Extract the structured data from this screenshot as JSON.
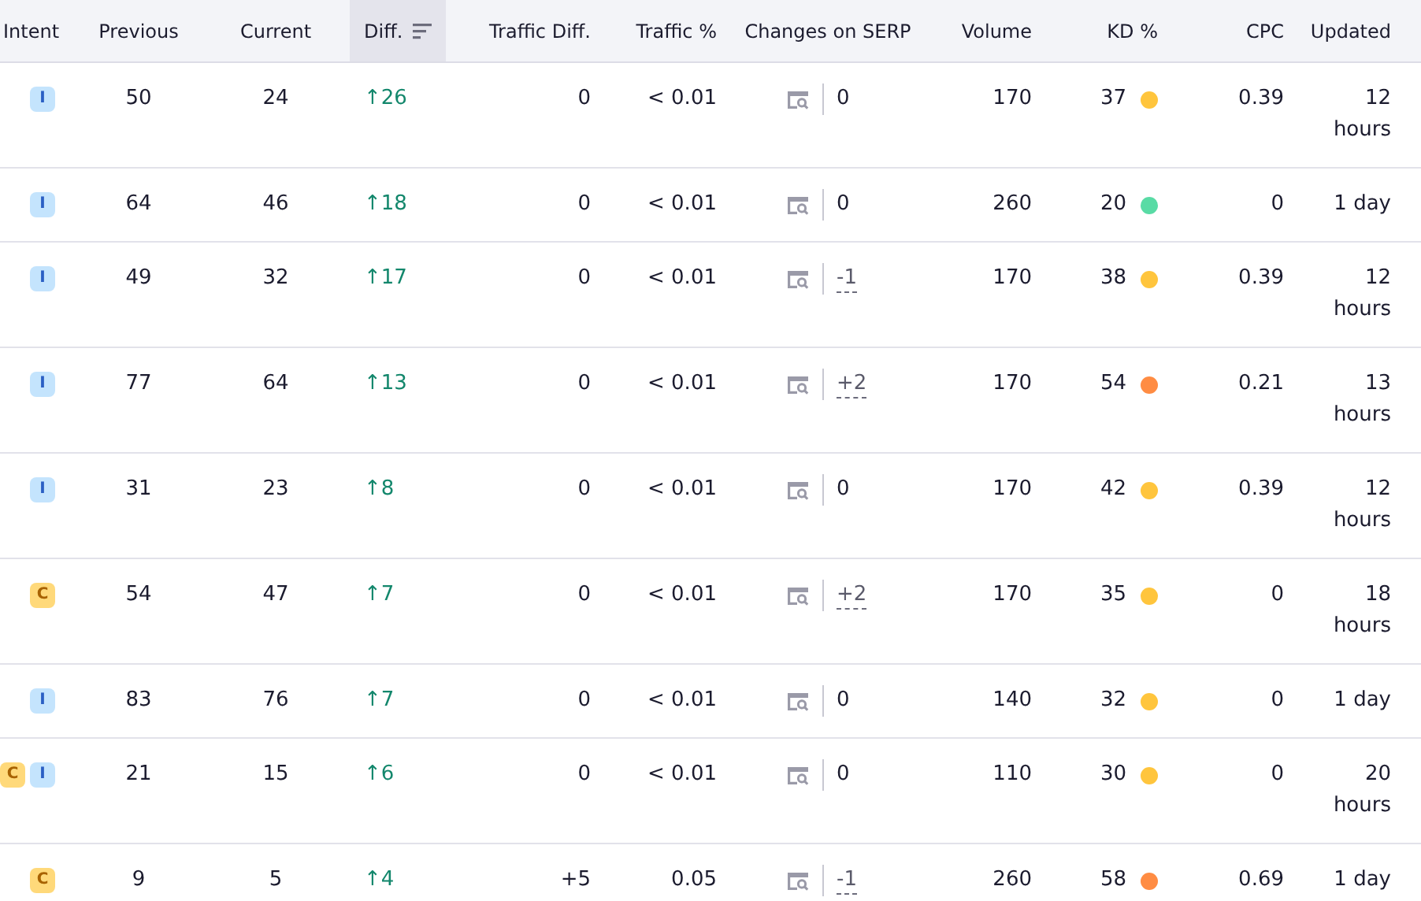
{
  "table": {
    "columns": [
      {
        "label": "Intent",
        "sorted": false
      },
      {
        "label": "Previous",
        "sorted": false
      },
      {
        "label": "Current",
        "sorted": false
      },
      {
        "label": "Diff.",
        "sorted": true
      },
      {
        "label": "Traffic Diff.",
        "sorted": false
      },
      {
        "label": "Traffic %",
        "sorted": false
      },
      {
        "label": "Changes on SERP",
        "sorted": false
      },
      {
        "label": "Volume",
        "sorted": false
      },
      {
        "label": "KD %",
        "sorted": false
      },
      {
        "label": "CPC",
        "sorted": false
      },
      {
        "label": "Updated",
        "sorted": false
      }
    ],
    "rows": [
      {
        "intents": [
          {
            "kind": "informational",
            "label": "I"
          }
        ],
        "previous": "50",
        "current": "24",
        "diff": "↑26",
        "traffic_diff": "0",
        "traffic_pct": "< 0.01",
        "serp_changes": {
          "value": "0",
          "underlined": false
        },
        "volume": "170",
        "kd": {
          "value": "37",
          "color": "#ffc53d"
        },
        "cpc": "0.39",
        "updated": "12 hours"
      },
      {
        "intents": [
          {
            "kind": "informational",
            "label": "I"
          }
        ],
        "previous": "64",
        "current": "46",
        "diff": "↑18",
        "traffic_diff": "0",
        "traffic_pct": "< 0.01",
        "serp_changes": {
          "value": "0",
          "underlined": false
        },
        "volume": "260",
        "kd": {
          "value": "20",
          "color": "#59dba5"
        },
        "cpc": "0",
        "updated": "1 day"
      },
      {
        "intents": [
          {
            "kind": "informational",
            "label": "I"
          }
        ],
        "previous": "49",
        "current": "32",
        "diff": "↑17",
        "traffic_diff": "0",
        "traffic_pct": "< 0.01",
        "serp_changes": {
          "value": "-1",
          "underlined": true
        },
        "volume": "170",
        "kd": {
          "value": "38",
          "color": "#ffc53d"
        },
        "cpc": "0.39",
        "updated": "12 hours"
      },
      {
        "intents": [
          {
            "kind": "informational",
            "label": "I"
          }
        ],
        "previous": "77",
        "current": "64",
        "diff": "↑13",
        "traffic_diff": "0",
        "traffic_pct": "< 0.01",
        "serp_changes": {
          "value": "+2",
          "underlined": true
        },
        "volume": "170",
        "kd": {
          "value": "54",
          "color": "#ff8c43"
        },
        "cpc": "0.21",
        "updated": "13 hours"
      },
      {
        "intents": [
          {
            "kind": "informational",
            "label": "I"
          }
        ],
        "previous": "31",
        "current": "23",
        "diff": "↑8",
        "traffic_diff": "0",
        "traffic_pct": "< 0.01",
        "serp_changes": {
          "value": "0",
          "underlined": false
        },
        "volume": "170",
        "kd": {
          "value": "42",
          "color": "#ffc53d"
        },
        "cpc": "0.39",
        "updated": "12 hours"
      },
      {
        "intents": [
          {
            "kind": "commercial",
            "label": "C"
          }
        ],
        "previous": "54",
        "current": "47",
        "diff": "↑7",
        "traffic_diff": "0",
        "traffic_pct": "< 0.01",
        "serp_changes": {
          "value": "+2",
          "underlined": true
        },
        "volume": "170",
        "kd": {
          "value": "35",
          "color": "#ffc53d"
        },
        "cpc": "0",
        "updated": "18 hours"
      },
      {
        "intents": [
          {
            "kind": "informational",
            "label": "I"
          }
        ],
        "previous": "83",
        "current": "76",
        "diff": "↑7",
        "traffic_diff": "0",
        "traffic_pct": "< 0.01",
        "serp_changes": {
          "value": "0",
          "underlined": false
        },
        "volume": "140",
        "kd": {
          "value": "32",
          "color": "#ffc53d"
        },
        "cpc": "0",
        "updated": "1 day"
      },
      {
        "intents": [
          {
            "kind": "commercial",
            "label": "C"
          },
          {
            "kind": "informational",
            "label": "I"
          }
        ],
        "previous": "21",
        "current": "15",
        "diff": "↑6",
        "traffic_diff": "0",
        "traffic_pct": "< 0.01",
        "serp_changes": {
          "value": "0",
          "underlined": false
        },
        "volume": "110",
        "kd": {
          "value": "30",
          "color": "#ffc53d"
        },
        "cpc": "0",
        "updated": "20 hours"
      },
      {
        "intents": [
          {
            "kind": "commercial",
            "label": "C"
          }
        ],
        "previous": "9",
        "current": "5",
        "diff": "↑4",
        "traffic_diff": "+5",
        "traffic_pct": "0.05",
        "serp_changes": {
          "value": "-1",
          "underlined": true
        },
        "volume": "260",
        "kd": {
          "value": "58",
          "color": "#ff8c43"
        },
        "cpc": "0.69",
        "updated": "1 day"
      }
    ]
  }
}
